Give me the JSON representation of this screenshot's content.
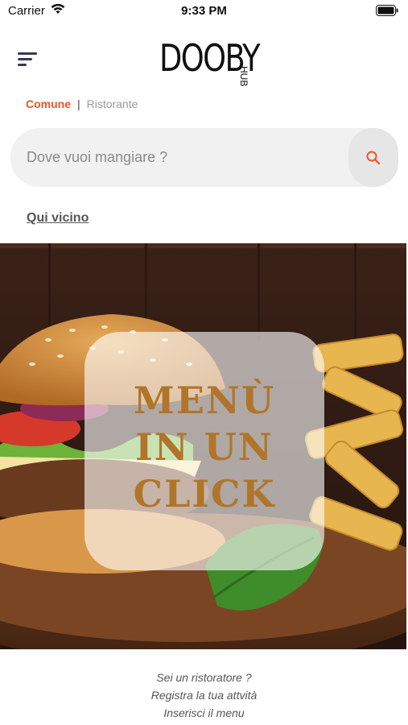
{
  "status_bar": {
    "carrier": "Carrier",
    "time": "9:33 PM"
  },
  "header": {
    "logo_text": "DOOBY",
    "logo_sub": "HUB"
  },
  "tabs": {
    "active": "Comune",
    "separator": "|",
    "inactive": "Ristorante"
  },
  "search": {
    "placeholder": "Dove vuoi mangiare ?",
    "icon": "search-icon"
  },
  "near_link": "Qui vicino",
  "banner": {
    "line1": "MENÙ",
    "line2": "IN UN",
    "line3": "CLICK"
  },
  "footer": {
    "line1": "Sei un ristoratore ?",
    "line2": "Registra la tua attvità",
    "line3": "Inserisci il menu"
  },
  "colors": {
    "accent": "#e8562a",
    "menu_icon": "#333a55"
  }
}
